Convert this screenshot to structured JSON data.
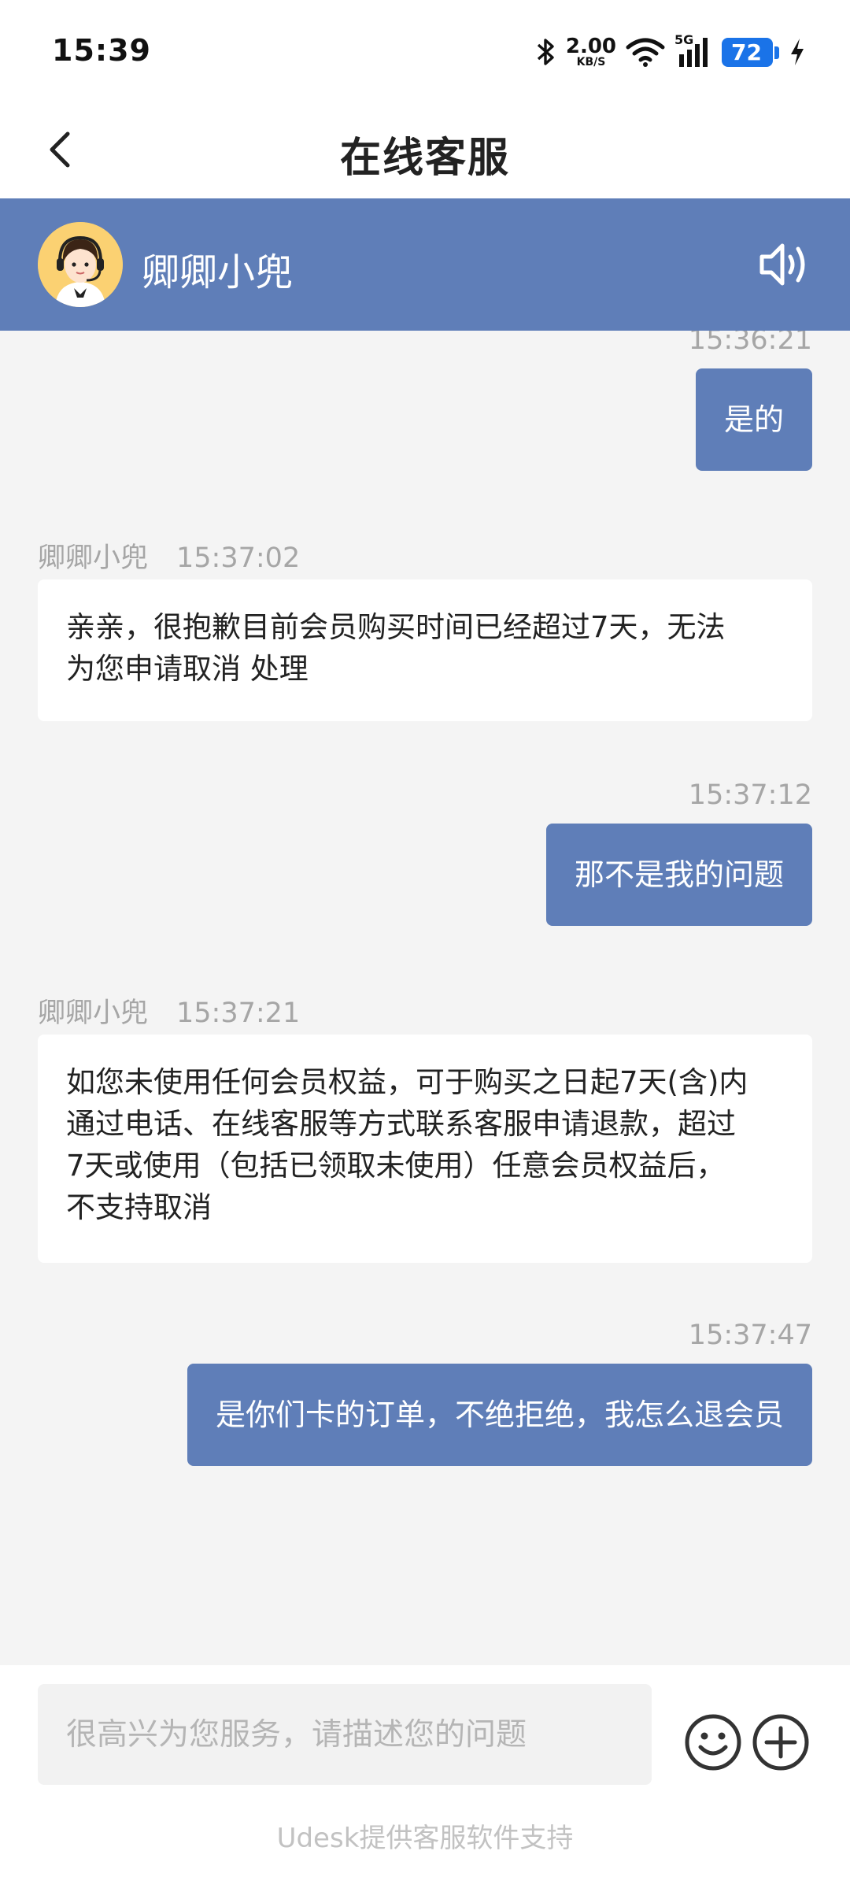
{
  "status_bar": {
    "time": "15:39",
    "net_speed": "2.00",
    "net_unit": "KB/S",
    "signal": "5G",
    "battery": "72"
  },
  "header": {
    "title": "在线客服"
  },
  "agent": {
    "name": "卿卿小兜",
    "avatar_icon": "agent-avatar-icon",
    "sound_icon": "speaker-icon"
  },
  "messages": [
    {
      "from": "user",
      "time": "15:36:21",
      "text": "是的"
    },
    {
      "from": "agent",
      "sender": "卿卿小兜",
      "time": "15:37:02",
      "lines": [
        "亲亲，很抱歉目前会员购买时间已经超过7天，无法",
        "为您申请取消 处理"
      ]
    },
    {
      "from": "user",
      "time": "15:37:12",
      "text": "那不是我的问题"
    },
    {
      "from": "agent",
      "sender": "卿卿小兜",
      "time": "15:37:21",
      "lines": [
        "如您未使用任何会员权益，可于购买之日起7天(含)内",
        "通过电话、在线客服等方式联系客服申请退款，超过",
        "7天或使用（包括已领取未使用）任意会员权益后，",
        "不支持取消"
      ]
    },
    {
      "from": "user",
      "time": "15:37:47",
      "text": "是你们卡的订单，不绝拒绝，我怎么退会员"
    }
  ],
  "composer": {
    "placeholder": "很高兴为您服务，请描述您的问题",
    "emoji_icon": "emoji-icon",
    "plus_icon": "plus-circle-icon"
  },
  "footer": {
    "powered_by": "Udesk提供客服软件支持"
  },
  "colors": {
    "accent": "#5f7eb8",
    "background": "#f4f4f4",
    "battery": "#1a73e8"
  }
}
